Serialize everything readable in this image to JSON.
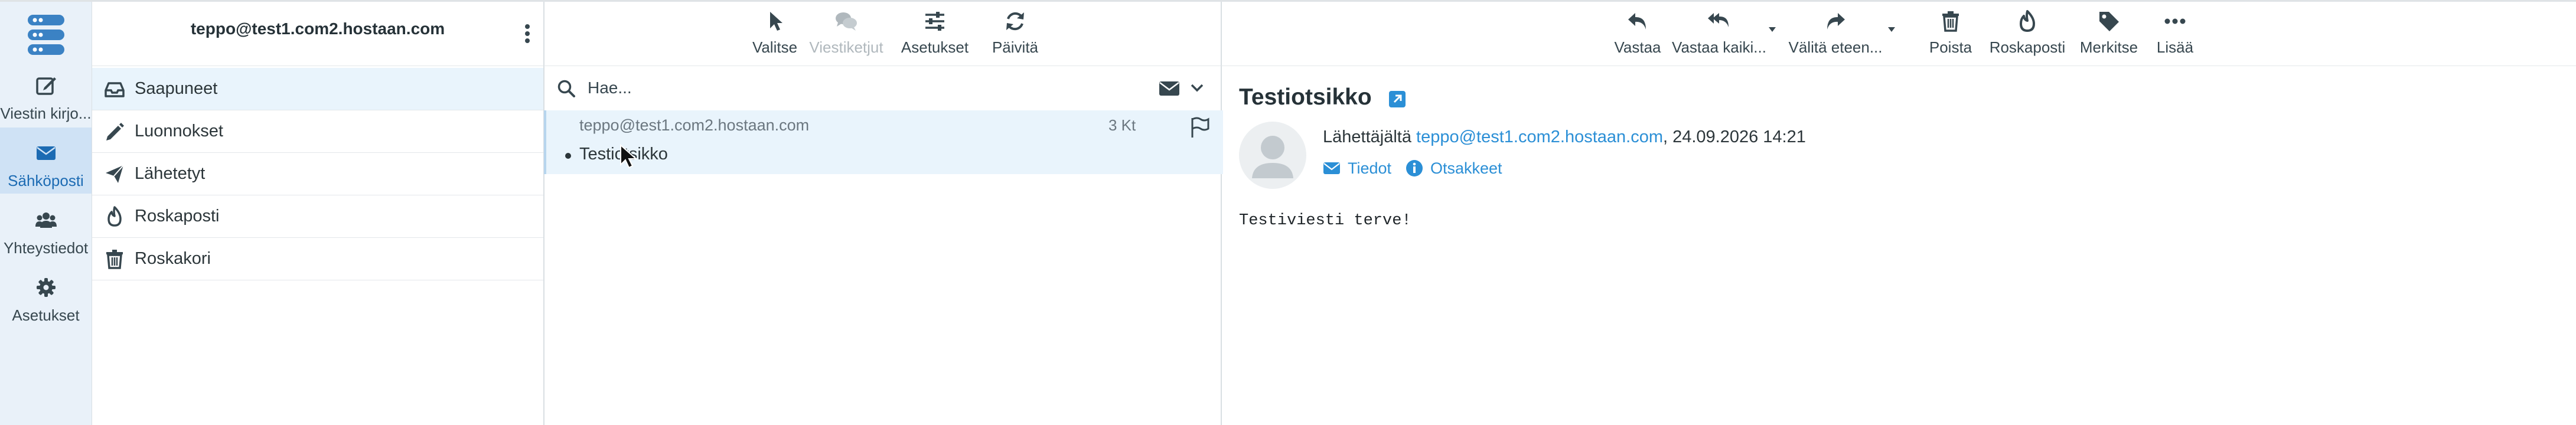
{
  "colors": {
    "accent": "#2b8fd6",
    "nav_bg": "#e9f1f9",
    "nav_active": "#cfe2f5",
    "selected_bg": "#e9f4fc",
    "logo": "#3b82c4"
  },
  "nav": {
    "items": [
      {
        "label": "Viestin kirjo...",
        "icon": "compose-icon"
      },
      {
        "label": "Sähköposti",
        "icon": "envelope-icon",
        "active": true
      },
      {
        "label": "Yhteystiedot",
        "icon": "contacts-icon"
      },
      {
        "label": "Asetukset",
        "icon": "gear-icon"
      }
    ]
  },
  "account": {
    "email": "teppo@test1.com2.hostaan.com"
  },
  "folders": [
    {
      "label": "Saapuneet",
      "icon": "inbox-icon",
      "selected": true
    },
    {
      "label": "Luonnokset",
      "icon": "pencil-icon"
    },
    {
      "label": "Lähetetyt",
      "icon": "paper-plane-icon"
    },
    {
      "label": "Roskaposti",
      "icon": "fire-icon"
    },
    {
      "label": "Roskakori",
      "icon": "trash-icon"
    }
  ],
  "list_toolbar": {
    "select": "Valitse",
    "threads": "Viestiketjut",
    "settings": "Asetukset",
    "refresh": "Päivitä"
  },
  "search": {
    "placeholder": "Hae..."
  },
  "message": {
    "from": "teppo@test1.com2.hostaan.com",
    "size": "3 Kt",
    "subject": "Testiotsikko"
  },
  "view_toolbar": {
    "reply": "Vastaa",
    "reply_all": "Vastaa kaiki...",
    "forward": "Välitä eteen...",
    "delete": "Poista",
    "spam": "Roskaposti",
    "mark": "Merkitse",
    "more": "Lisää"
  },
  "view": {
    "subject": "Testiotsikko",
    "sender_prefix": "Lähettäjältä",
    "sender_email": "teppo@test1.com2.hostaan.com",
    "date": ", 24.09.2026 14:21",
    "details_link": "Tiedot",
    "headers_link": "Otsakkeet",
    "body": "Testiviesti terve!"
  }
}
